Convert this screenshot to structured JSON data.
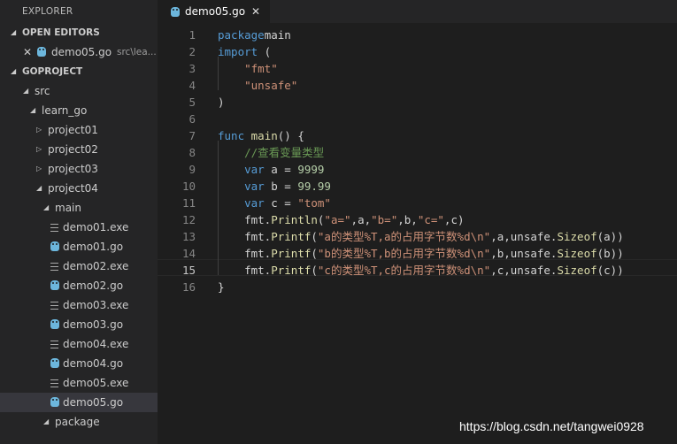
{
  "sidebar": {
    "title": "EXPLORER",
    "open_editors": {
      "label": "OPEN EDITORS",
      "items": [
        {
          "close": "✕",
          "name": "demo05.go",
          "description": "src\\lea..."
        }
      ]
    },
    "project": {
      "label": "GOPROJECT",
      "tree": [
        {
          "label": "src",
          "kind": "folder-open"
        },
        {
          "label": "learn_go",
          "kind": "folder-open"
        },
        {
          "label": "project01",
          "kind": "folder-closed"
        },
        {
          "label": "project02",
          "kind": "folder-closed"
        },
        {
          "label": "project03",
          "kind": "folder-closed"
        },
        {
          "label": "project04",
          "kind": "folder-open"
        },
        {
          "label": "main",
          "kind": "folder-open"
        },
        {
          "label": "demo01.exe",
          "kind": "exe-file"
        },
        {
          "label": "demo01.go",
          "kind": "go-file"
        },
        {
          "label": "demo02.exe",
          "kind": "exe-file"
        },
        {
          "label": "demo02.go",
          "kind": "go-file"
        },
        {
          "label": "demo03.exe",
          "kind": "exe-file"
        },
        {
          "label": "demo03.go",
          "kind": "go-file"
        },
        {
          "label": "demo04.exe",
          "kind": "exe-file"
        },
        {
          "label": "demo04.go",
          "kind": "go-file"
        },
        {
          "label": "demo05.exe",
          "kind": "exe-file"
        },
        {
          "label": "demo05.go",
          "kind": "go-file",
          "selected": true
        },
        {
          "label": "package",
          "kind": "folder-open"
        }
      ]
    }
  },
  "editor": {
    "tab": {
      "name": "demo05.go",
      "close": "✕"
    },
    "current_line": 15,
    "lines": [
      [
        [
          "kw",
          "package"
        ],
        [
          "",
          "main"
        ]
      ],
      [
        [
          "kw",
          "import"
        ],
        [
          "",
          " ("
        ]
      ],
      [
        [
          "",
          "    "
        ],
        [
          "str",
          "\"fmt\""
        ]
      ],
      [
        [
          "",
          "    "
        ],
        [
          "str",
          "\"unsafe\""
        ]
      ],
      [
        [
          "",
          ")"
        ]
      ],
      [],
      [
        [
          "kw",
          "func"
        ],
        [
          "",
          " "
        ],
        [
          "fn",
          "main"
        ],
        [
          "",
          "() {"
        ]
      ],
      [
        [
          "",
          "    "
        ],
        [
          "cm",
          "//查看变量类型"
        ]
      ],
      [
        [
          "",
          "    "
        ],
        [
          "kw",
          "var"
        ],
        [
          "",
          " a = "
        ],
        [
          "num",
          "9999"
        ]
      ],
      [
        [
          "",
          "    "
        ],
        [
          "kw",
          "var"
        ],
        [
          "",
          " b = "
        ],
        [
          "num",
          "99.99"
        ]
      ],
      [
        [
          "",
          "    "
        ],
        [
          "kw",
          "var"
        ],
        [
          "",
          " c = "
        ],
        [
          "str",
          "\"tom\""
        ]
      ],
      [
        [
          "",
          "    fmt."
        ],
        [
          "fn",
          "Println"
        ],
        [
          "",
          "("
        ],
        [
          "str",
          "\"a=\""
        ],
        [
          "",
          ",a,"
        ],
        [
          "str",
          "\"b=\""
        ],
        [
          "",
          ",b,"
        ],
        [
          "str",
          "\"c=\""
        ],
        [
          "",
          ",c)"
        ]
      ],
      [
        [
          "",
          "    fmt."
        ],
        [
          "fn",
          "Printf"
        ],
        [
          "",
          "("
        ],
        [
          "str",
          "\"a的类型%T,a的占用字节数%d\\n\""
        ],
        [
          "",
          ",a,unsafe."
        ],
        [
          "fn",
          "Sizeof"
        ],
        [
          "",
          "(a))"
        ]
      ],
      [
        [
          "",
          "    fmt."
        ],
        [
          "fn",
          "Printf"
        ],
        [
          "",
          "("
        ],
        [
          "str",
          "\"b的类型%T,b的占用字节数%d\\n\""
        ],
        [
          "",
          ",b,unsafe."
        ],
        [
          "fn",
          "Sizeof"
        ],
        [
          "",
          "(b))"
        ]
      ],
      [
        [
          "",
          "    fmt."
        ],
        [
          "fn",
          "Printf"
        ],
        [
          "",
          "("
        ],
        [
          "str",
          "\"c的类型%T,c的占用字节数%d\\n\""
        ],
        [
          "",
          ",c,unsafe."
        ],
        [
          "fn",
          "Sizeof"
        ],
        [
          "",
          "(c))"
        ]
      ],
      [
        [
          "",
          "}"
        ]
      ]
    ]
  },
  "watermark": "https://blog.csdn.net/tangwei0928"
}
